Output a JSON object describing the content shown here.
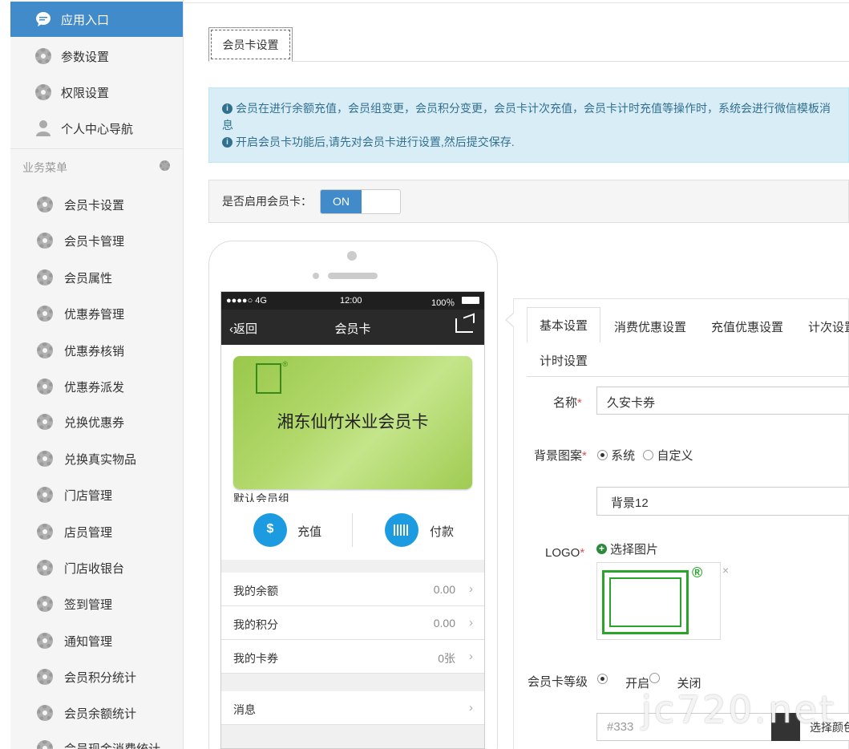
{
  "sidebar": {
    "top_items": [
      {
        "label": "应用入口",
        "icon": "chat-bubble-icon",
        "active": true
      },
      {
        "label": "参数设置",
        "icon": "gear-icon"
      },
      {
        "label": "权限设置",
        "icon": "gear-icon"
      },
      {
        "label": "个人中心导航",
        "icon": "user-icon"
      }
    ],
    "section_label": "业务菜单",
    "biz_items": [
      {
        "label": "会员卡设置"
      },
      {
        "label": "会员卡管理"
      },
      {
        "label": "会员属性"
      },
      {
        "label": "优惠券管理"
      },
      {
        "label": "优惠券核销"
      },
      {
        "label": "优惠券派发"
      },
      {
        "label": "兑换优惠券"
      },
      {
        "label": "兑换真实物品"
      },
      {
        "label": "门店管理"
      },
      {
        "label": "店员管理"
      },
      {
        "label": "门店收银台"
      },
      {
        "label": "签到管理"
      },
      {
        "label": "通知管理"
      },
      {
        "label": "会员积分统计"
      },
      {
        "label": "会员余额统计"
      },
      {
        "label": "会员现金消费统计"
      }
    ]
  },
  "main": {
    "tab_label": "会员卡设置",
    "alert": {
      "line1": "会员在进行余额充值，会员组变更，会员积分变更，会员卡计次充值，会员卡计时充值等操作时，系统会进行微信模板消",
      "line1b": "息",
      "line2": "开启会员卡功能后,请先对会员卡进行设置,然后提交保存."
    },
    "enable_label": "是否启用会员卡：",
    "switch_on": "ON"
  },
  "phone": {
    "signal": "●●●●○ 4G",
    "time": "12:00",
    "battery": "100％",
    "back": "返回",
    "title": "会员卡",
    "card_name": "湘东仙竹米业会员卡",
    "card_group": "默认会员组",
    "charge": "充值",
    "pay": "付款",
    "rows": [
      {
        "label": "我的余额",
        "value": "0.00"
      },
      {
        "label": "我的积分",
        "value": "0.00"
      },
      {
        "label": "我的卡券",
        "value": "0张"
      }
    ],
    "message": "消息"
  },
  "panel": {
    "tabs": [
      "基本设置",
      "消费优惠设置",
      "充值优惠设置",
      "计次设置",
      "计时设置"
    ],
    "name_label": "名称",
    "name_value": "久安卡券",
    "bg_label": "背景图案",
    "bg_option_system": "系统",
    "bg_option_custom": "自定义",
    "bg_value": "背景12",
    "logo_label": "LOGO",
    "logo_pick": "选择图片",
    "logo_close": "×",
    "level_label": "会员卡等级",
    "level_on": "开启",
    "level_off": "关闭",
    "color_value": "#333",
    "color_button": "选择颜色"
  },
  "watermark": "jc720.net"
}
